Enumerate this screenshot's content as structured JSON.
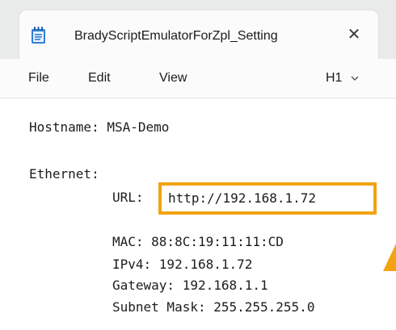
{
  "window": {
    "tab_title": "BradyScriptEmulatorForZpl_Setting",
    "close_glyph": "✕",
    "tab_icon": "notepad-icon"
  },
  "menu": {
    "file": "File",
    "edit": "Edit",
    "view": "View",
    "heading": "H1"
  },
  "content": {
    "hostname_line": "Hostname: MSA-Demo",
    "ethernet_label": "Ethernet:",
    "url_key": "URL:",
    "url_value": "http://192.168.1.72",
    "mac_line": "MAC: 88:8C:19:11:11:CD",
    "ipv4_line": "IPv4: 192.168.1.72",
    "gateway_line": "Gateway: 192.168.1.1",
    "subnet_line": "Subnet Mask: 255.255.255.0"
  },
  "colors": {
    "highlight": "#f2a312",
    "icon_blue": "#2f7fd6"
  }
}
